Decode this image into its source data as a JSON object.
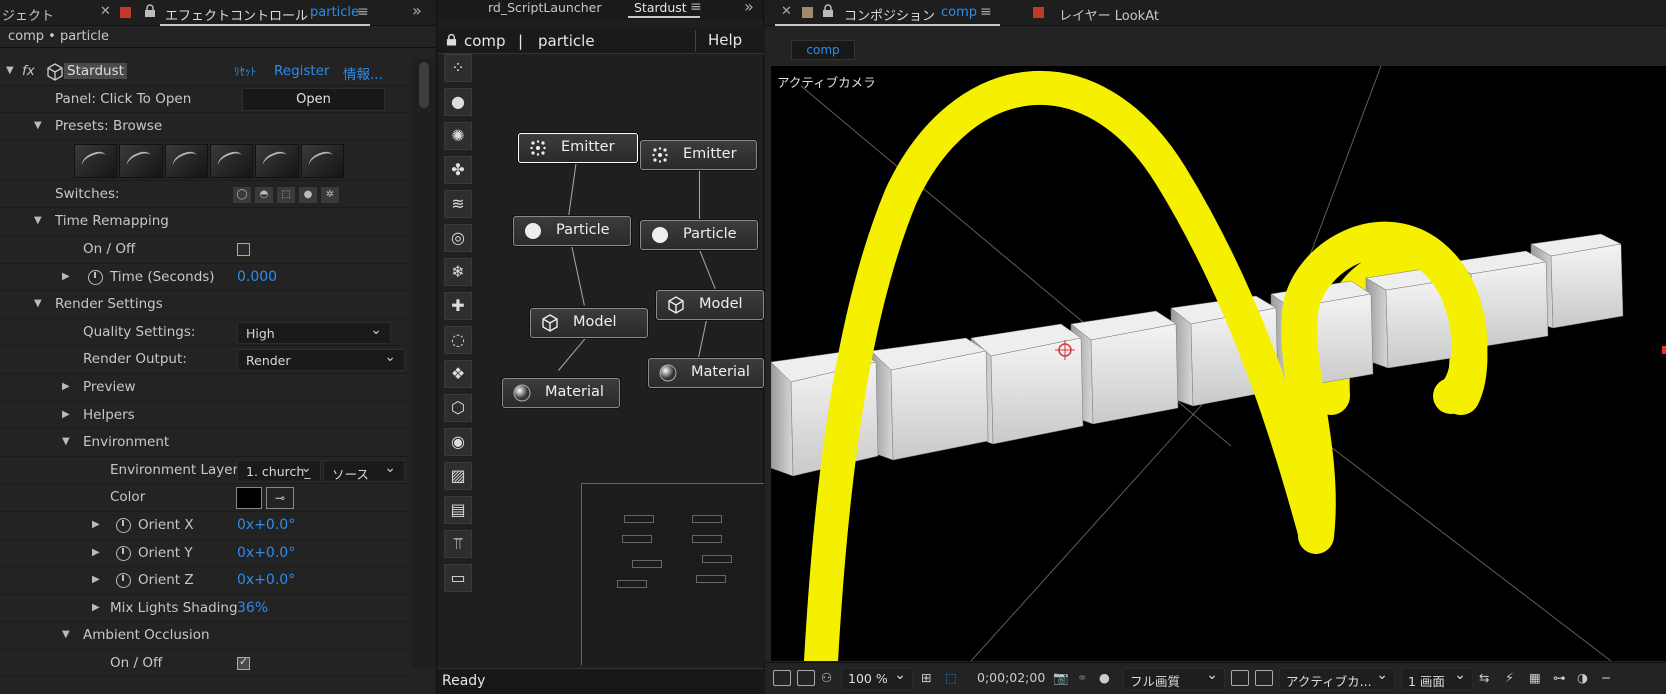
{
  "left": {
    "tab_prefix": "ジェクト",
    "tab_title": "エフェクトコントロール",
    "tab_layer": "particle",
    "breadcrumb": "comp • particle",
    "effect_name": "Stardust",
    "reset": "ﾘｾｯﾄ",
    "register": "Register",
    "info": "情報...",
    "panel_label": "Panel: Click To Open",
    "open_btn": "Open",
    "presets_label": "Presets: Browse",
    "switches_label": "Switches:",
    "time_remap": "Time Remapping",
    "onoff": "On / Off",
    "time_seconds": "Time (Seconds)",
    "time_value": "0.000",
    "render_settings": "Render Settings",
    "quality_label": "Quality Settings:",
    "quality_value": "High",
    "render_output_label": "Render Output:",
    "render_output_value": "Render",
    "preview": "Preview",
    "helpers": "Helpers",
    "environment": "Environment",
    "env_layer_label": "Environment Layer",
    "env_layer_value": "1. church_",
    "env_source_value": "ソース",
    "color_label": "Color",
    "orient_x": "Orient X",
    "orient_y": "Orient Y",
    "orient_z": "Orient Z",
    "orient_x_val": "0x+0.0°",
    "orient_y_val": "0x+0.0°",
    "orient_z_val": "0x+0.0°",
    "mix_lights": "Mix Lights Shading",
    "mix_lights_val": "36%",
    "ambient_occ": "Ambient Occlusion",
    "ao_onoff": "On / Off"
  },
  "mid": {
    "tab1": "rd_ScriptLauncher",
    "tab2": "Stardust",
    "comp": "comp",
    "sep": "|",
    "layer": "particle",
    "help": "Help",
    "nodes": {
      "emitter1": "Emitter",
      "emitter2": "Emitter",
      "particle1": "Particle",
      "particle2": "Particle",
      "model1": "Model",
      "model2": "Model",
      "material1": "Material",
      "material2": "Material"
    },
    "status": "Ready"
  },
  "right": {
    "tab_comp": "コンポジション",
    "tab_comp_name": "comp",
    "tab_layer": "レイヤー LookAt",
    "subtab": "comp",
    "camera_label": "アクティブカメラ",
    "zoom": "100 %",
    "timecode": "0;00;02;00",
    "resolution": "フル画質",
    "camera_view": "アクティブカ...",
    "views": "1 画面"
  },
  "colors": {
    "accent_blue": "#2d8ceb",
    "red_label": "#c0392b",
    "tan_label": "#a08b6a",
    "yellow_ribbon": "#f5f000"
  }
}
